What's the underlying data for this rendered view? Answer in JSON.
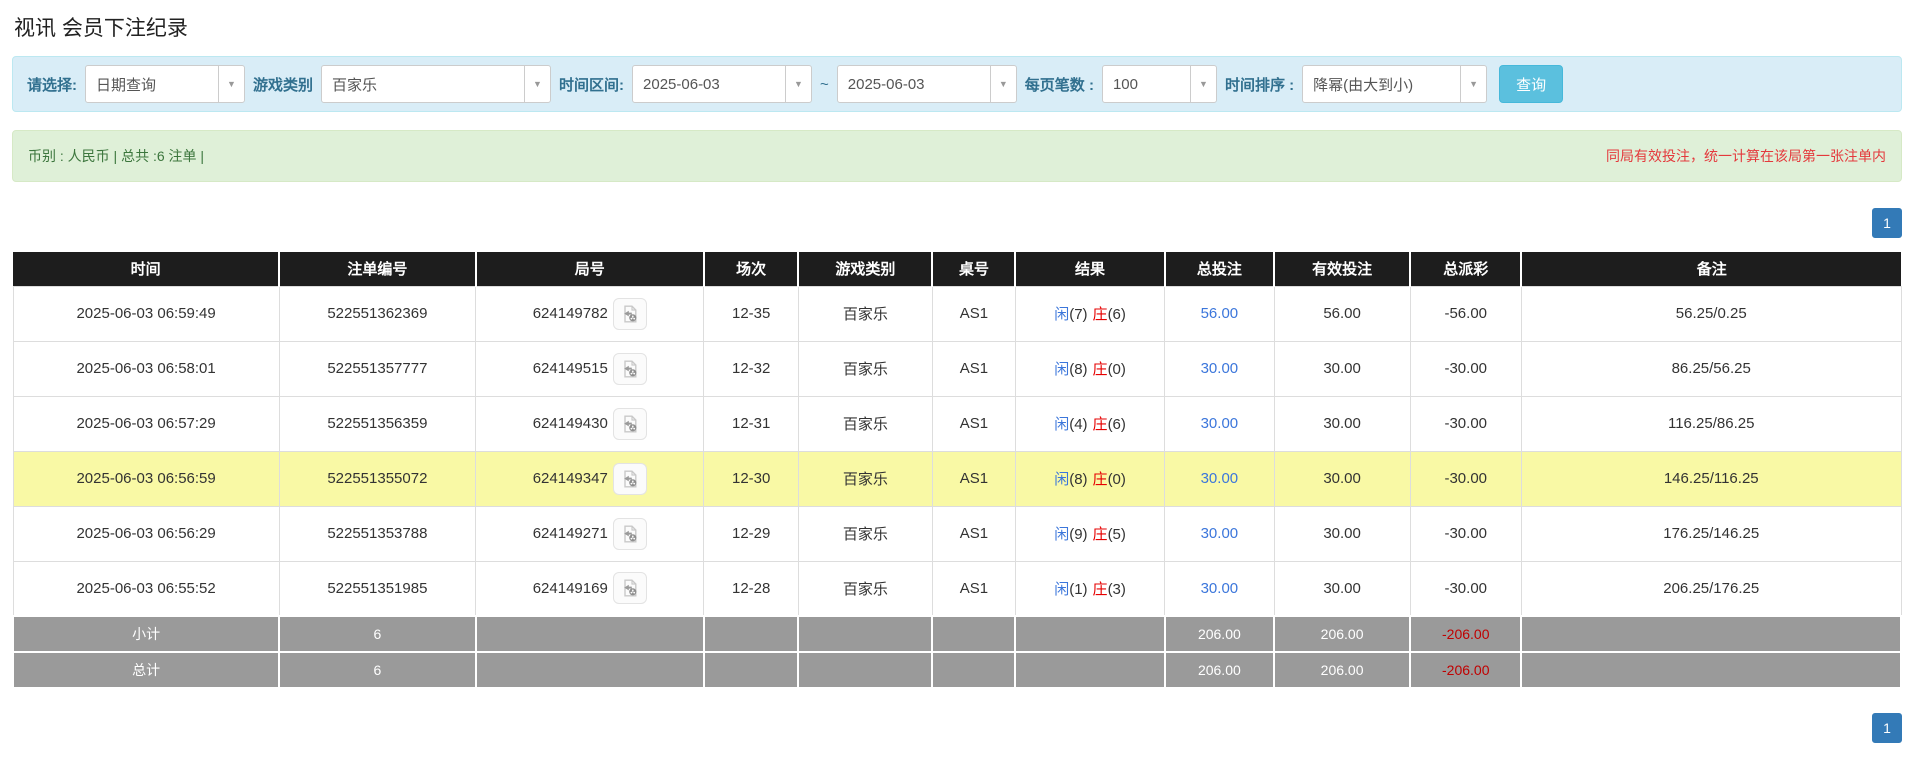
{
  "page": {
    "title": "视讯 会员下注纪录"
  },
  "icons": {
    "caret_down": "▼"
  },
  "filter": {
    "query_type": {
      "label": "请选择:",
      "value": "日期查询"
    },
    "game_type": {
      "label": "游戏类别",
      "value": "百家乐"
    },
    "time_range": {
      "label": "时间区间:",
      "from": "2025-06-03",
      "separator": "~",
      "to": "2025-06-03"
    },
    "page_size": {
      "label": "每页笔数 :",
      "value": "100"
    },
    "sort": {
      "label": "时间排序 :",
      "value": "降幂(由大到小)"
    },
    "search_button_label": "查询"
  },
  "summary_bar": {
    "currency_info": "币别 : 人民币 | 总共 :6 注单 |",
    "notice": "同局有效投注，统一计算在该局第一张注单内"
  },
  "pagination": {
    "top_page": "1",
    "bottom_page": "1"
  },
  "table": {
    "headers": [
      "时间",
      "注单编号",
      "局号",
      "场次",
      "游戏类别",
      "桌号",
      "结果",
      "总投注",
      "有效投注",
      "总派彩",
      "备注"
    ],
    "rows": [
      {
        "time": "2025-06-03 06:59:49",
        "bet_no": "522551362369",
        "round_no": "624149782",
        "session": "12-35",
        "game_type": "百家乐",
        "table_no": "AS1",
        "result": {
          "player_label": "闲",
          "player_value": "(7)",
          "banker_label": "庄",
          "banker_value": "(6)"
        },
        "total_bet": "56.00",
        "valid_bet": "56.00",
        "payout": "-56.00",
        "remark": "56.25/0.25",
        "highlighted": false
      },
      {
        "time": "2025-06-03 06:58:01",
        "bet_no": "522551357777",
        "round_no": "624149515",
        "session": "12-32",
        "game_type": "百家乐",
        "table_no": "AS1",
        "result": {
          "player_label": "闲",
          "player_value": "(8)",
          "banker_label": "庄",
          "banker_value": "(0)"
        },
        "total_bet": "30.00",
        "valid_bet": "30.00",
        "payout": "-30.00",
        "remark": "86.25/56.25",
        "highlighted": false
      },
      {
        "time": "2025-06-03 06:57:29",
        "bet_no": "522551356359",
        "round_no": "624149430",
        "session": "12-31",
        "game_type": "百家乐",
        "table_no": "AS1",
        "result": {
          "player_label": "闲",
          "player_value": "(4)",
          "banker_label": "庄",
          "banker_value": "(6)"
        },
        "total_bet": "30.00",
        "valid_bet": "30.00",
        "payout": "-30.00",
        "remark": "116.25/86.25",
        "highlighted": false
      },
      {
        "time": "2025-06-03 06:56:59",
        "bet_no": "522551355072",
        "round_no": "624149347",
        "session": "12-30",
        "game_type": "百家乐",
        "table_no": "AS1",
        "result": {
          "player_label": "闲",
          "player_value": "(8)",
          "banker_label": "庄",
          "banker_value": "(0)"
        },
        "total_bet": "30.00",
        "valid_bet": "30.00",
        "payout": "-30.00",
        "remark": "146.25/116.25",
        "highlighted": true
      },
      {
        "time": "2025-06-03 06:56:29",
        "bet_no": "522551353788",
        "round_no": "624149271",
        "session": "12-29",
        "game_type": "百家乐",
        "table_no": "AS1",
        "result": {
          "player_label": "闲",
          "player_value": "(9)",
          "banker_label": "庄",
          "banker_value": "(5)"
        },
        "total_bet": "30.00",
        "valid_bet": "30.00",
        "payout": "-30.00",
        "remark": "176.25/146.25",
        "highlighted": false
      },
      {
        "time": "2025-06-03 06:55:52",
        "bet_no": "522551351985",
        "round_no": "624149169",
        "session": "12-28",
        "game_type": "百家乐",
        "table_no": "AS1",
        "result": {
          "player_label": "闲",
          "player_value": "(1)",
          "banker_label": "庄",
          "banker_value": "(3)"
        },
        "total_bet": "30.00",
        "valid_bet": "30.00",
        "payout": "-30.00",
        "remark": "206.25/176.25",
        "highlighted": false
      }
    ],
    "subtotal_row": {
      "label": "小计",
      "count": "6",
      "total_bet": "206.00",
      "valid_bet": "206.00",
      "payout": "-206.00"
    },
    "total_row": {
      "label": "总计",
      "count": "6",
      "total_bet": "206.00",
      "valid_bet": "206.00",
      "payout": "-206.00"
    }
  }
}
